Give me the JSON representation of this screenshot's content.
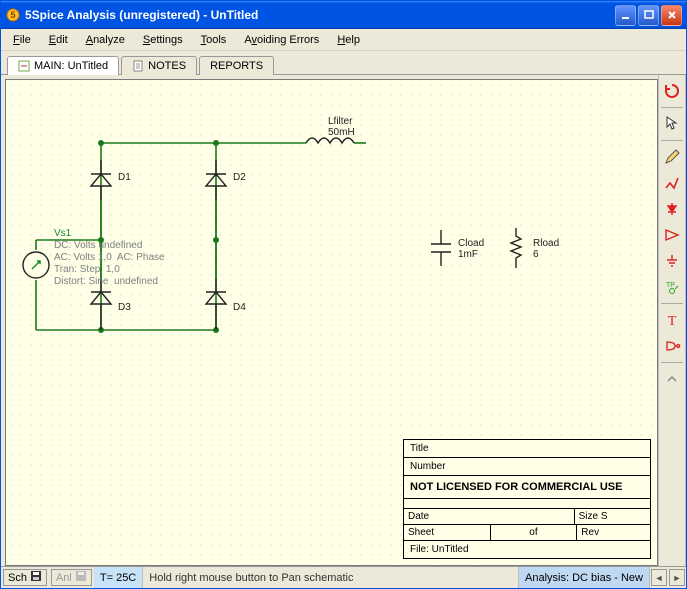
{
  "window": {
    "title": "5Spice Analysis (unregistered) - UnTitled"
  },
  "menus": {
    "file": "File",
    "edit": "Edit",
    "analyze": "Analyze",
    "settings": "Settings",
    "tools": "Tools",
    "avoiding_errors": "Avoiding Errors",
    "help": "Help"
  },
  "tabs": {
    "main": "MAIN:  UnTitled",
    "notes": "NOTES",
    "reports": "REPORTS"
  },
  "schematic": {
    "lfilter": {
      "name": "Lfilter",
      "value": "50mH"
    },
    "d1": "D1",
    "d2": "D2",
    "d3": "D3",
    "d4": "D4",
    "cload": {
      "name": "Cload",
      "value": "1mF"
    },
    "rload": {
      "name": "Rload",
      "value": "6"
    },
    "vs1": {
      "name": "Vs1",
      "line1": "DC: Volts undefined",
      "line2": "AC: Volts 1,0  AC: Phase",
      "line3": "Tran: Step  1,0",
      "line4": "Distort: Sine  undefined"
    }
  },
  "titleblock": {
    "title_label": "Title",
    "number_label": "Number",
    "license": "NOT LICENSED FOR COMMERCIAL USE",
    "date_label": "Date",
    "size_label": "Size    S",
    "sheet_label": "Sheet",
    "of_label": "of",
    "rev_label": "Rev",
    "file_label": "File:  UnTitled"
  },
  "status": {
    "sch": "Sch",
    "anl": "Anl",
    "temp": "T= 25C",
    "hint": "Hold right mouse button to Pan schematic",
    "analysis": "Analysis:  DC bias - New"
  }
}
